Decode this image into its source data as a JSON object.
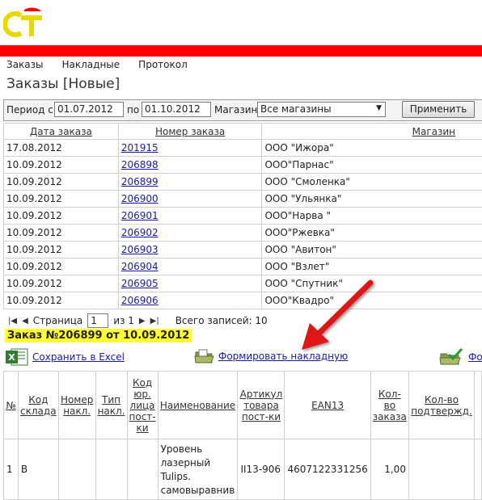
{
  "logo": {
    "text": "CT"
  },
  "menu": [
    "Заказы",
    "Накладные",
    "Протокол"
  ],
  "page_title": "Заказы [Новые]",
  "filter": {
    "period_label": "Период с",
    "from": "01.07.2012",
    "to_label": "по",
    "to": "01.10.2012",
    "store_label": "Магазин",
    "store_value": "Все магазины",
    "apply": "Применить"
  },
  "orders": {
    "headers": [
      "Дата заказа",
      "Номер заказа",
      "Магазин"
    ],
    "rows": [
      {
        "date": "17.08.2012",
        "num": "201915",
        "store": "ООО \"Ижора\""
      },
      {
        "date": "10.09.2012",
        "num": "206898",
        "store": "ООО\"Парнас\""
      },
      {
        "date": "10.09.2012",
        "num": "206899",
        "store": "ООО \"Смоленка\""
      },
      {
        "date": "10.09.2012",
        "num": "206900",
        "store": "ООО \"Ульянка\""
      },
      {
        "date": "10.09.2012",
        "num": "206901",
        "store": "ООО\"Нарва \""
      },
      {
        "date": "10.09.2012",
        "num": "206902",
        "store": "ООО\"Ржевка\""
      },
      {
        "date": "10.09.2012",
        "num": "206903",
        "store": "ООО \"Авитон\""
      },
      {
        "date": "10.09.2012",
        "num": "206904",
        "store": "ООО \"Взлет\""
      },
      {
        "date": "10.09.2012",
        "num": "206905",
        "store": "ООО \"Спутник\""
      },
      {
        "date": "10.09.2012",
        "num": "206906",
        "store": "ООО\"Квадро\""
      }
    ]
  },
  "pager": {
    "page_label": "Страница",
    "page": "1",
    "of": "из 1",
    "total": "Всего записей: 10"
  },
  "order_caption": "Заказ №206899 от 10.09.2012",
  "actions": {
    "excel": "Сохранить в Excel",
    "invoice": "Формировать накладную",
    "third": "Фор"
  },
  "items": {
    "headers": [
      "№",
      "Код склада",
      "Номер накл.",
      "Тип накл.",
      "Код юр. лица пост-ки",
      "Наименование",
      "Артикул товара пост-ки",
      "EAN13",
      "Кол-во заказа",
      "Кол-во подтвержд.",
      ""
    ],
    "row": {
      "n": "1",
      "code": "В",
      "num": "",
      "type": "",
      "legal": "",
      "name": "Уровень лазерный Tulips. самовыравнив",
      "art": "II13-906",
      "ean": "4607122331256",
      "qty": "1,00",
      "conf": "",
      "extra": ""
    }
  },
  "colors": {
    "brand_red": "#ff0000",
    "logo_yellow": "#e6d800",
    "highlight": "#ffff33",
    "link": "#1a1aa0"
  },
  "icons": [
    "logo-icon",
    "first-page-icon",
    "prev-page-icon",
    "next-page-icon",
    "last-page-icon",
    "excel-icon",
    "invoice-folder-icon",
    "folder-check-icon",
    "annotation-arrow-icon",
    "dropdown-arrow-icon"
  ]
}
